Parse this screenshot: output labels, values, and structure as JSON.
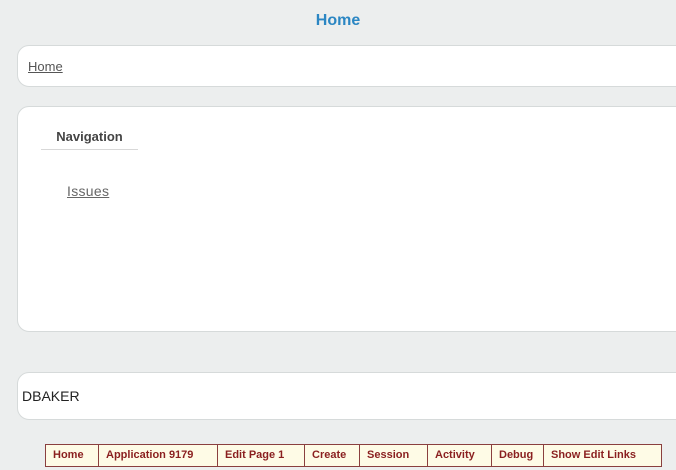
{
  "page": {
    "title": "Home"
  },
  "breadcrumb": {
    "items": [
      "Home"
    ]
  },
  "navigation": {
    "heading": "Navigation",
    "links": [
      "Issues"
    ]
  },
  "user": {
    "name": "DBAKER"
  },
  "developer_toolbar": {
    "items": [
      "Home",
      "Application 9179",
      "Edit Page 1",
      "Create",
      "Session",
      "Activity",
      "Debug",
      "Show Edit Links"
    ]
  }
}
